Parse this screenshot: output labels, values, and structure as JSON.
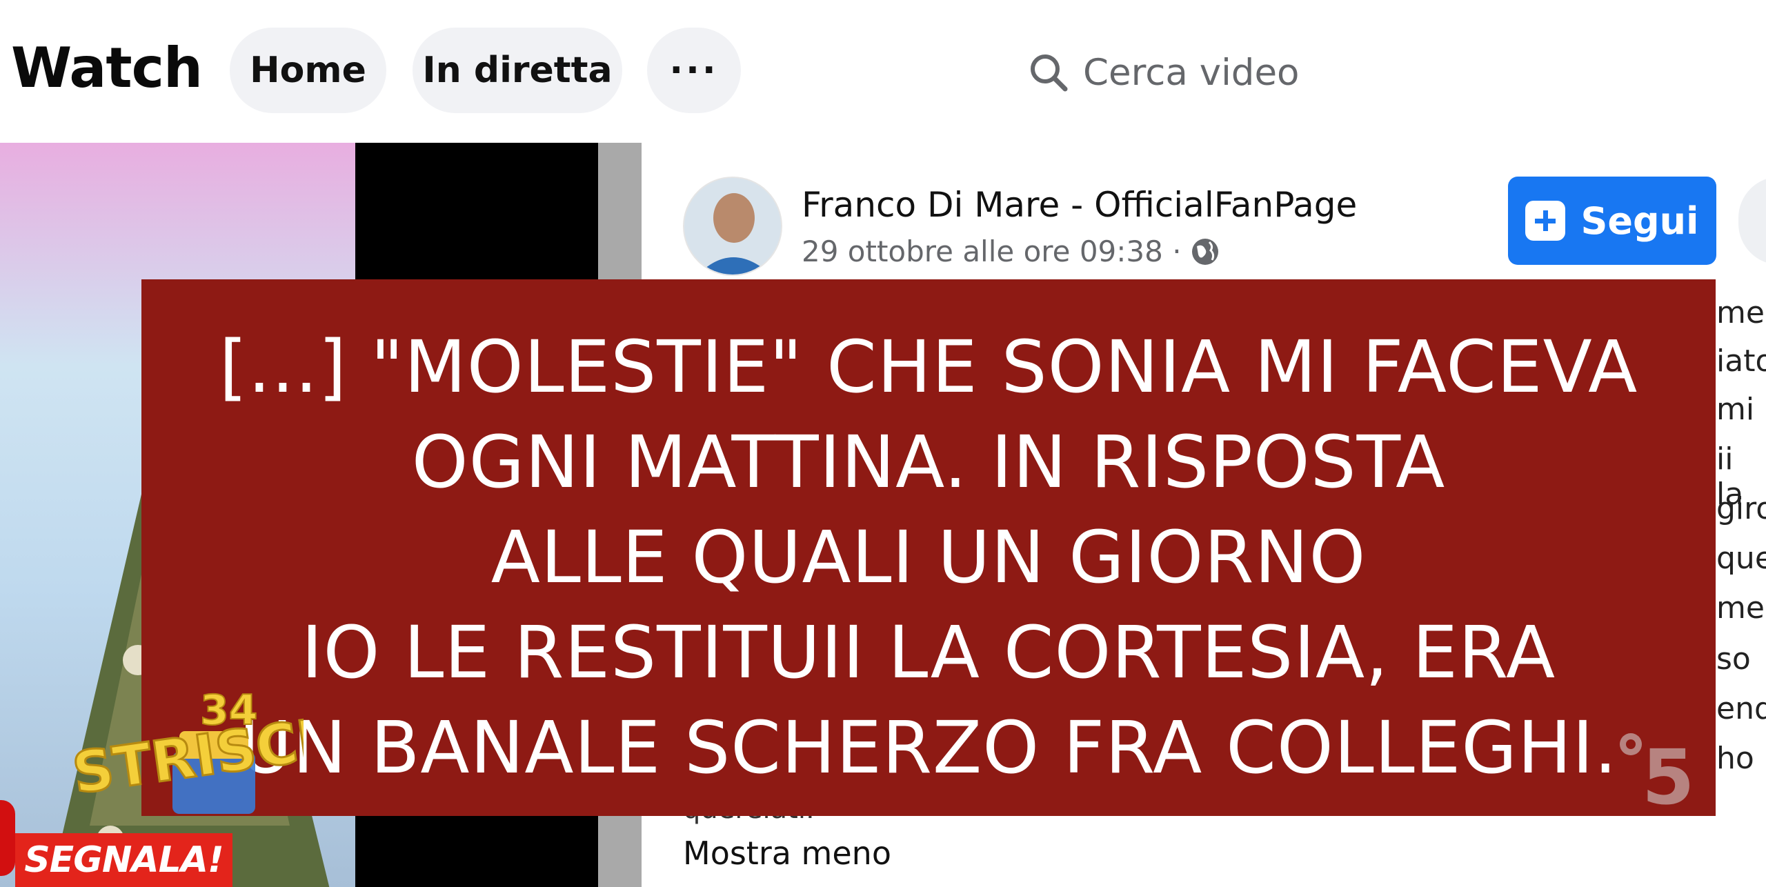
{
  "header": {
    "title": "Watch",
    "tabs": [
      {
        "label": "Home"
      },
      {
        "label": "In diretta"
      },
      {
        "label": "···"
      }
    ],
    "search": {
      "placeholder": "Cerca video"
    }
  },
  "post": {
    "page_name": "Franco Di Mare - OfficialFanPage",
    "date": "29 ottobre alle ore 09:38 ·",
    "follow_label": "Segui",
    "right_fragments": [
      "me",
      "iato",
      "mi",
      "ii la",
      "giro",
      "ques",
      "me",
      "so",
      "end",
      "ho"
    ],
    "truncated_text": "querelati.",
    "show_less": "Mostra meno"
  },
  "overlay": {
    "lines": [
      "[...] \"MOLESTIE\" CHE SONIA MI FACEVA",
      "OGNI MATTINA. IN RISPOSTA",
      "ALLE QUALI UN GIORNO",
      "IO LE RESTITUII LA CORTESIA, ERA",
      "UN BANALE SCHERZO FRA COLLEGHI."
    ],
    "color": "#8e1a14"
  },
  "broadcast": {
    "show_logo_text": "STRISCIA",
    "show_logo_number": "34",
    "segnala_label": "SEGNALA!",
    "channel_number": "5"
  }
}
